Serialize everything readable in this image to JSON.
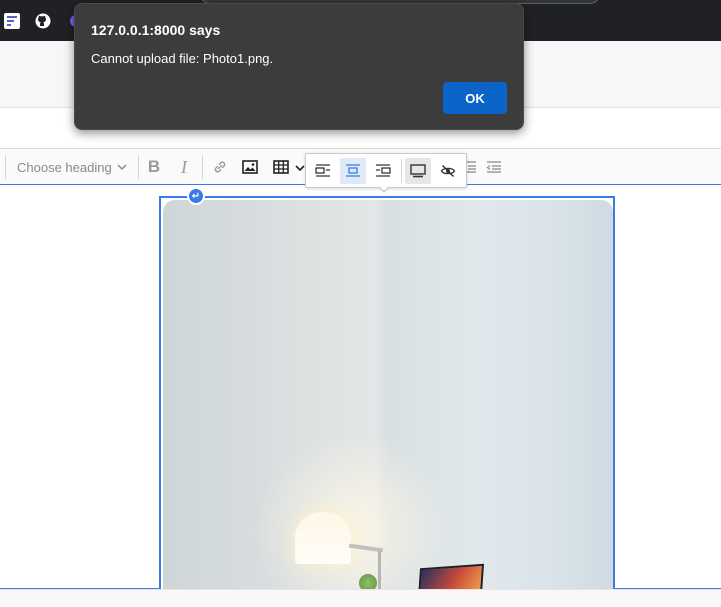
{
  "dialog": {
    "title": "127.0.0.1:8000 says",
    "message": "Cannot upload file: Photo1.png.",
    "ok_label": "OK"
  },
  "toolbar": {
    "heading_placeholder": "Choose heading",
    "bold_label": "B",
    "italic_label": "I"
  },
  "bookmarks": [
    {
      "icon": "forms-icon"
    },
    {
      "icon": "github-icon"
    },
    {
      "icon": "bookmark-icon"
    }
  ],
  "image_toolbar": {
    "items": [
      "align-left-icon",
      "align-center-icon",
      "align-right-icon",
      "toggle-caption-icon",
      "hide-icon"
    ]
  },
  "colors": {
    "accent": "#3b7be5",
    "dialog_bg": "#3c3c3c",
    "ok_button": "#0b64c8"
  }
}
